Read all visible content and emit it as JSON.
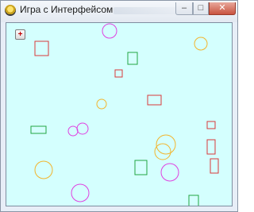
{
  "window": {
    "title": "Игра с Интерфейсом",
    "minimize_glyph": "–",
    "maximize_glyph": "□",
    "close_glyph": "✕"
  },
  "toolbar": {
    "add_shape_label": "+"
  },
  "colors": {
    "canvas_background": "#d4fffe",
    "red": "#d93a3a",
    "green": "#22a542",
    "orange": "#f2b42c",
    "magenta": "#e040e0"
  }
}
